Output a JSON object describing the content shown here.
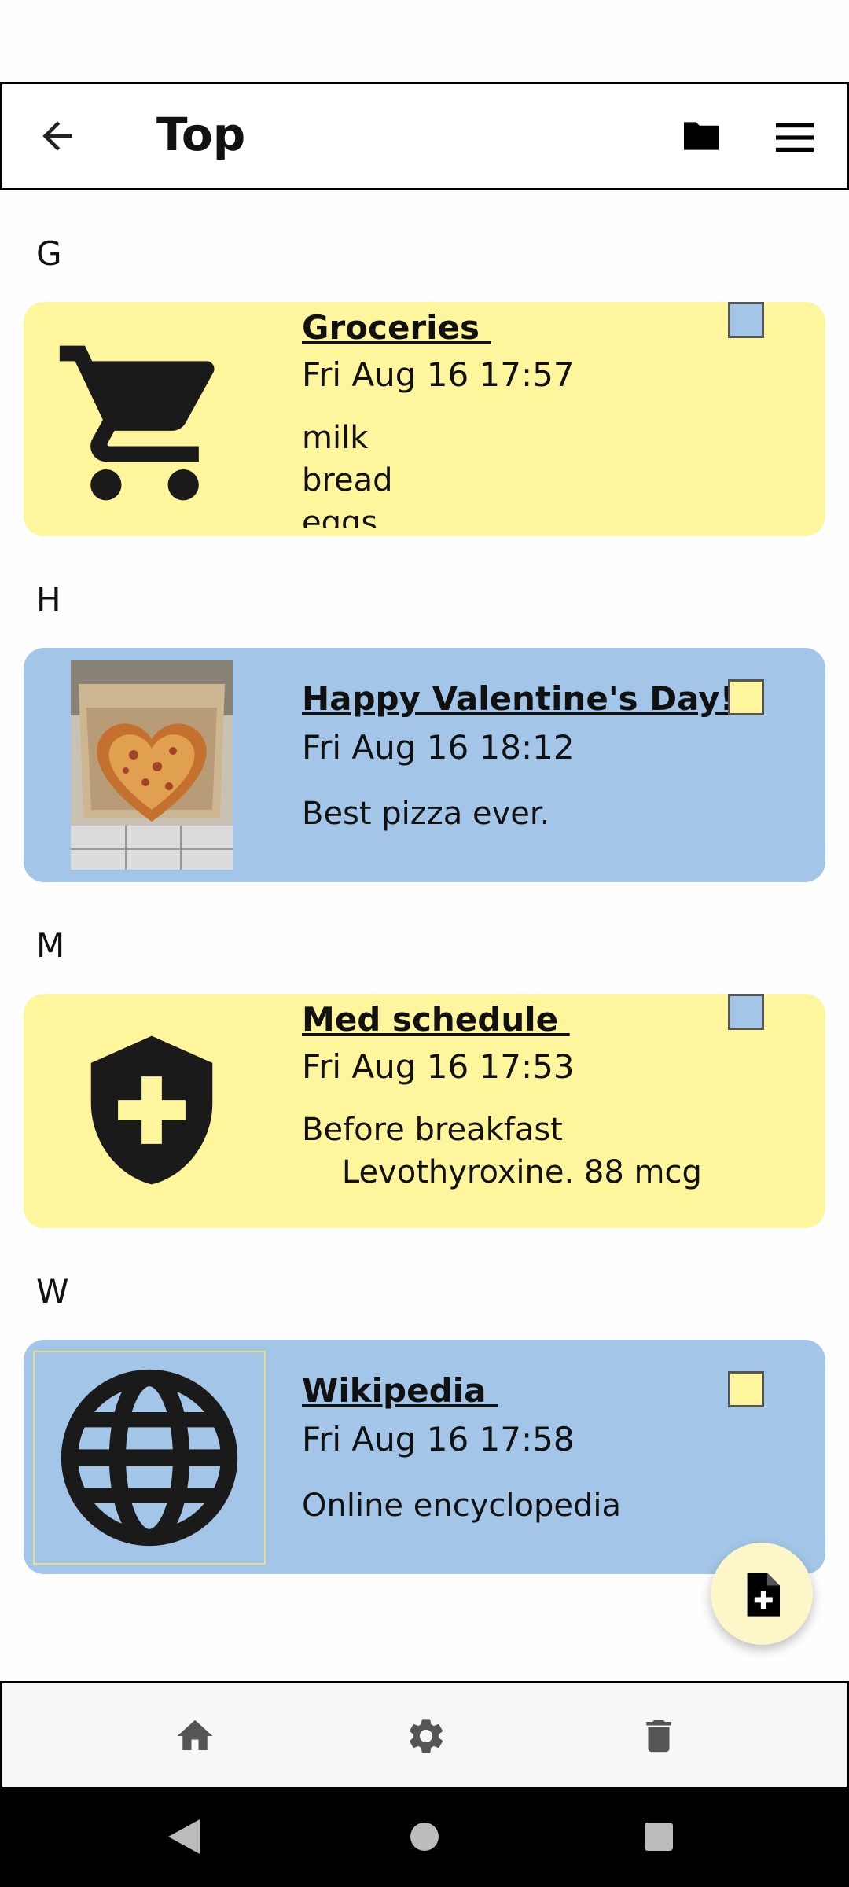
{
  "header": {
    "title": "Top",
    "back_icon": "arrow-left-icon",
    "folder_icon": "folder-icon",
    "menu_icon": "hamburger-menu-icon"
  },
  "sections": [
    "G",
    "H",
    "M",
    "W"
  ],
  "cards": [
    {
      "title": "Groceries ",
      "date": "Fri Aug 16 17:57",
      "body": "milk\nbread\neggs",
      "color": "#fff59d",
      "icon": "shopping-cart-icon"
    },
    {
      "title": "Happy Valentine's Day!",
      "date": "Fri Aug 16 18:12",
      "body": "Best pizza ever.",
      "color": "#a3c6e8",
      "icon": "pizza-photo"
    },
    {
      "title": "Med schedule ",
      "date": "Fri Aug 16 17:53",
      "body": "Before breakfast\n    Levothyroxine. 88 mcg",
      "color": "#fff59d",
      "icon": "medical-shield-icon"
    },
    {
      "title": "Wikipedia ",
      "date": "Fri Aug 16 17:58",
      "body": "Online encyclopedia",
      "color": "#a3c6e8",
      "icon": "globe-icon"
    }
  ],
  "fab": {
    "icon": "add-note-icon"
  },
  "bottom_nav": {
    "home_icon": "home-icon",
    "settings_icon": "gear-icon",
    "trash_icon": "trash-icon"
  },
  "system_nav": {
    "back": "triangle-back-icon",
    "home": "circle-home-icon",
    "recents": "square-recents-icon"
  }
}
